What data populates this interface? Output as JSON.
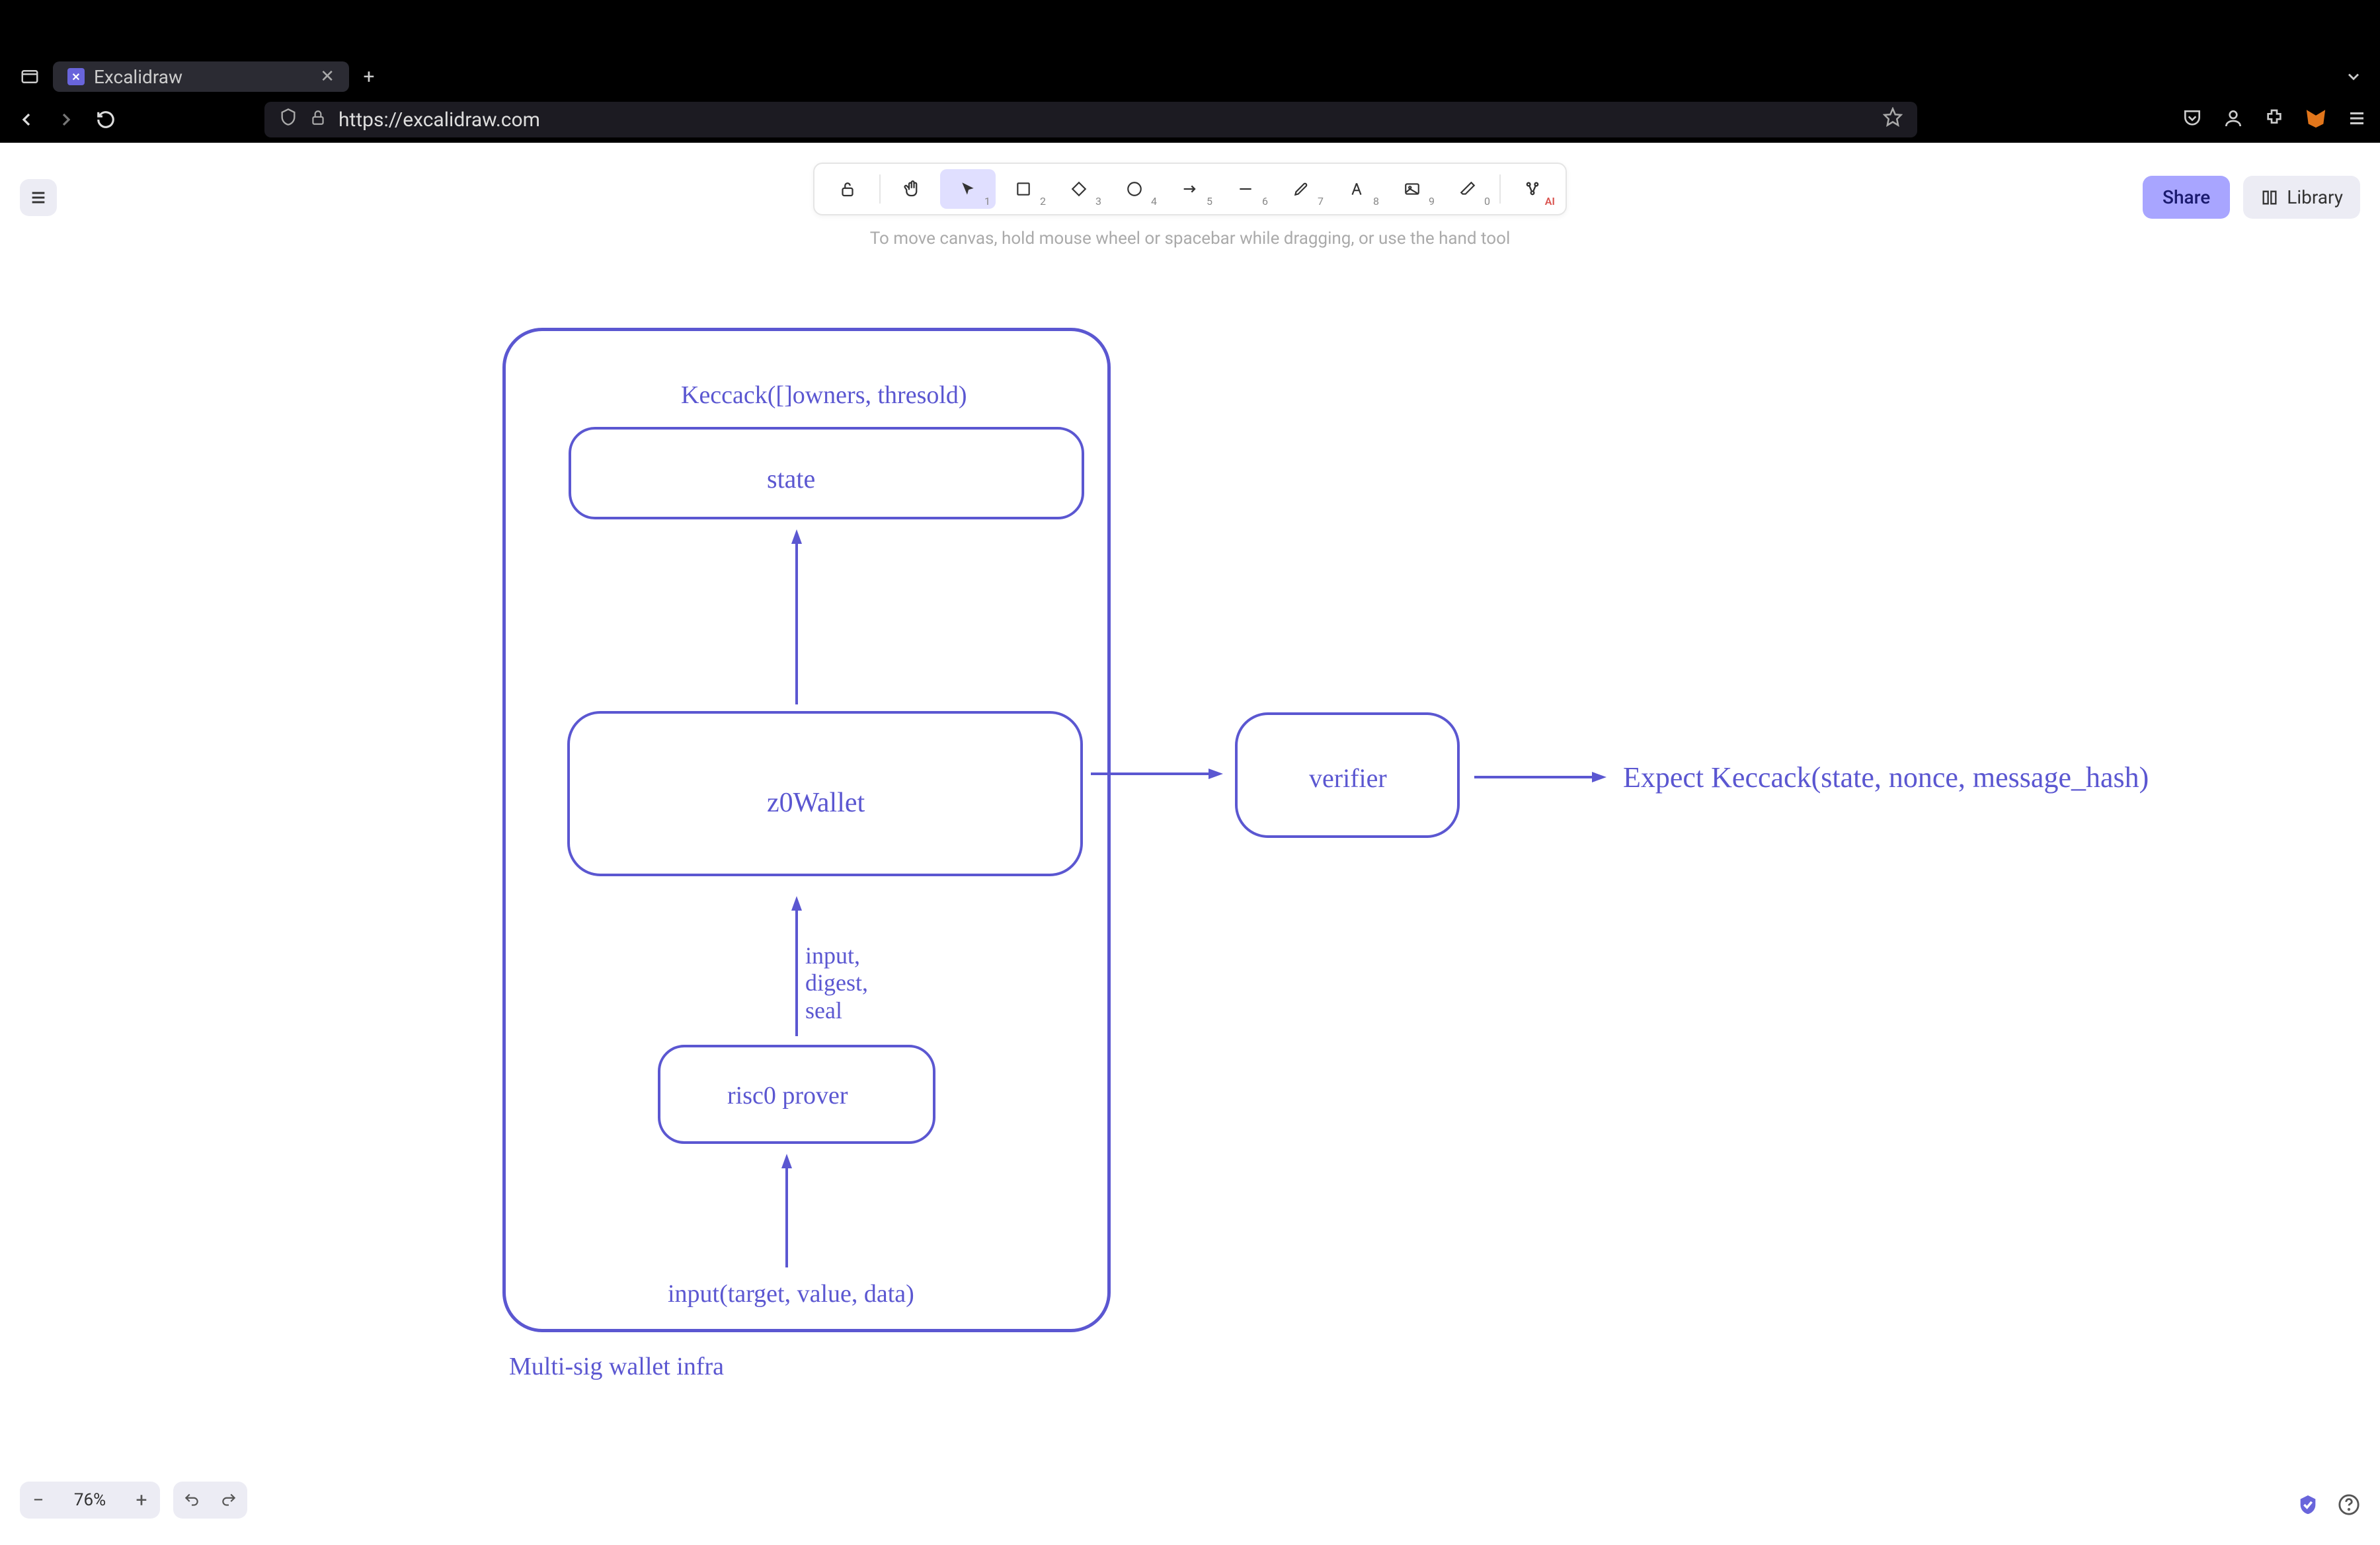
{
  "browser": {
    "tab_title": "Excalidraw",
    "url": "https://excalidraw.com"
  },
  "app": {
    "share_label": "Share",
    "library_label": "Library",
    "hint": "To move canvas, hold mouse wheel or spacebar while dragging, or use the hand tool",
    "zoom": "76%",
    "tool_numbers": [
      "1",
      "2",
      "3",
      "4",
      "5",
      "6",
      "7",
      "8",
      "9",
      "0",
      "AI"
    ]
  },
  "diagram": {
    "container_title": "Keccack([]owners, thresold)",
    "state": "state",
    "wallet": "z0Wallet",
    "prover": "risc0 prover",
    "verifier": "verifier",
    "expect": "Expect Keccack(state, nonce, message_hash)",
    "bottom_input": "input(target, value, data)",
    "caption": "Multi-sig wallet infra",
    "edge_prover_wallet": "input,\ndigest,\nseal"
  }
}
